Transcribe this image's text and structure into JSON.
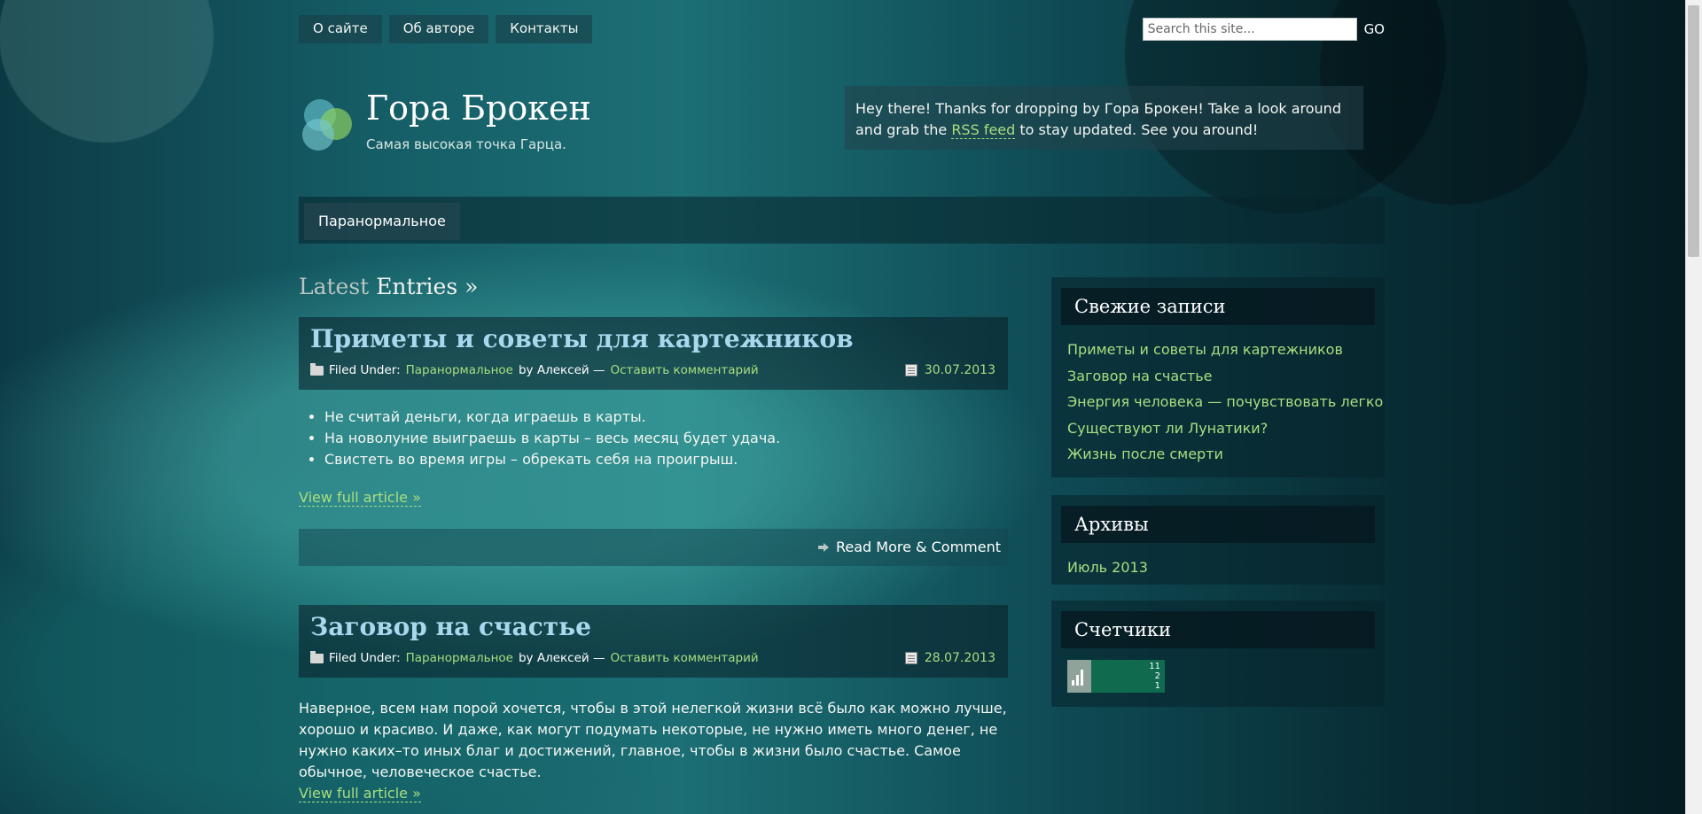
{
  "nav_pages": [
    "О сайте",
    "Об авторе",
    "Контакты"
  ],
  "search": {
    "placeholder": "Search this site...",
    "go_label": "GO"
  },
  "site": {
    "title": "Гора Брокен",
    "tagline": "Самая высокая точка Гарца."
  },
  "welcome": {
    "text_before": "Hey there! Thanks for dropping by Гора Брокен! Take a look around and grab the ",
    "rss_label": "RSS feed",
    "text_after": " to stay updated. See you around!"
  },
  "menu": {
    "item": "Паранормальное"
  },
  "latest": {
    "dim": "Latest",
    "bold": "Entries »"
  },
  "posts": [
    {
      "title": "Приметы и советы для картежников",
      "filed_label": "Filed Under:",
      "category": "Паранормальное",
      "by_label": "by Алексей —",
      "comment_link": "Оставить комментарий",
      "date": "30.07.2013",
      "bullets": [
        "Не считай деньги, когда играешь в карты.",
        "На новолуние выиграешь в карты – весь месяц будет удача.",
        "Свистеть во время игры – обрекать себя на проигрыш."
      ],
      "view_full": "View full article »",
      "read_more": "Read More & Comment"
    },
    {
      "title": "Заговор на счастье",
      "filed_label": "Filed Under:",
      "category": "Паранормальное",
      "by_label": "by Алексей —",
      "comment_link": "Оставить комментарий",
      "date": "28.07.2013",
      "excerpt": "Наверное, всем нам порой хочется, чтобы в этой нелегкой жизни всё было как можно лучше, хорошо и красиво. И даже, как могут подумать некоторые, не нужно иметь много денег, не нужно каких–то иных благ и достижений, главное, чтобы в жизни было счастье. Самое обычное, человеческое счастье.",
      "view_full": "View full article »"
    }
  ],
  "sidebar": {
    "recent": {
      "title": "Свежие записи",
      "items": [
        "Приметы и советы для картежников",
        "Заговор на счастье",
        "Энергия человека — почувствовать легко",
        "Существуют ли Лунатики?",
        "Жизнь после смерти"
      ]
    },
    "archives": {
      "title": "Архивы",
      "items": [
        "Июль 2013"
      ]
    },
    "counters": {
      "title": "Счетчики",
      "values": [
        "11",
        "2",
        "1"
      ]
    }
  }
}
